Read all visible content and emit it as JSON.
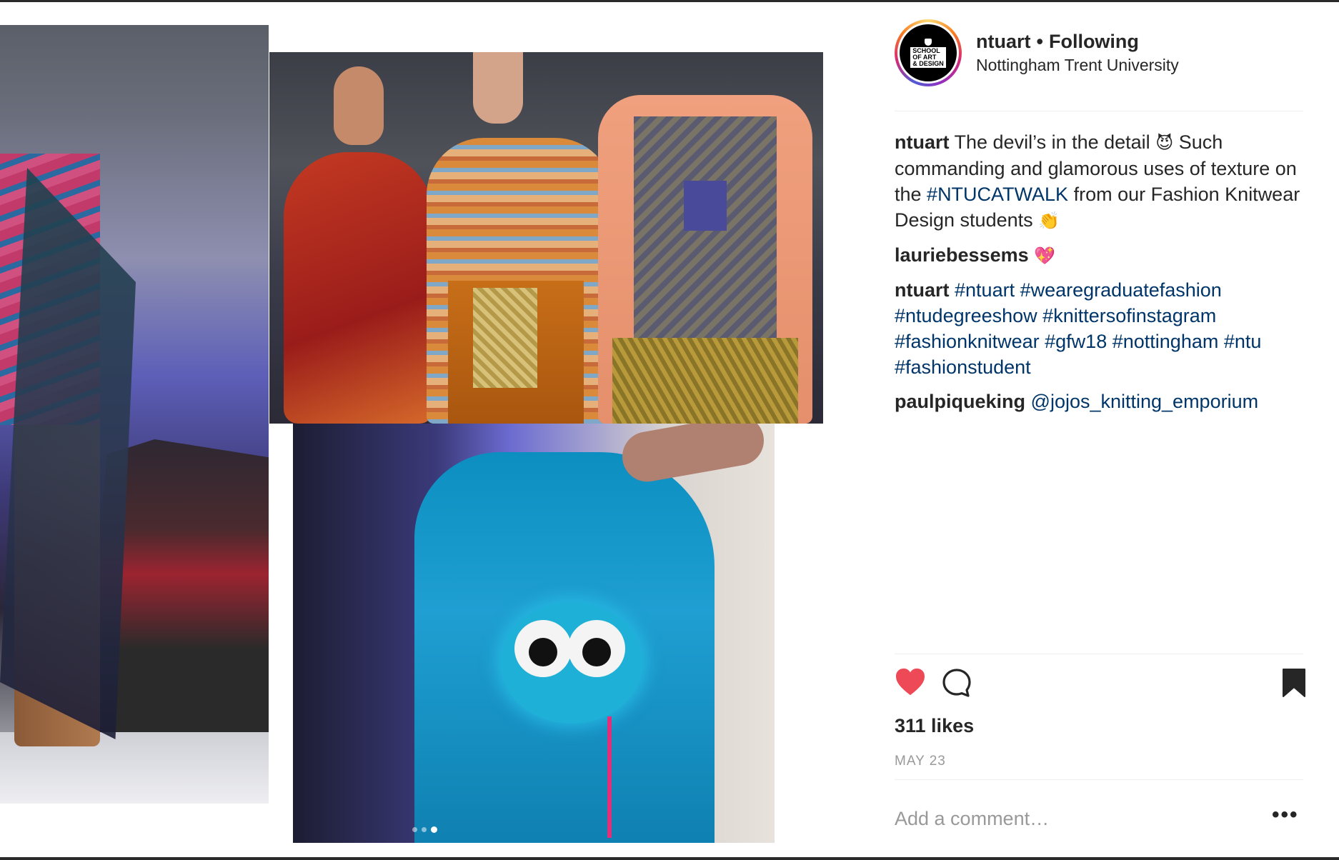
{
  "post": {
    "username": "ntuart",
    "separator": "•",
    "follow_status": "Following",
    "location": "Nottingham Trent University",
    "avatar_text": "SCHOOL\nOF ART\n& DESIGN"
  },
  "comments": [
    {
      "user": "ntuart",
      "segments": [
        {
          "type": "text",
          "value": " The devil’s in the detail "
        },
        {
          "type": "emoji",
          "value": "😈"
        },
        {
          "type": "text",
          "value": "  Such commanding and glamorous uses of texture on the "
        },
        {
          "type": "tag",
          "value": "#NTUCATWALK"
        },
        {
          "type": "text",
          "value": " from our Fashion Knitwear Design students "
        },
        {
          "type": "emoji",
          "value": "👏"
        }
      ]
    },
    {
      "user": "lauriebessems",
      "segments": [
        {
          "type": "text",
          "value": " "
        },
        {
          "type": "emoji",
          "value": "💖"
        }
      ]
    },
    {
      "user": "ntuart",
      "segments": [
        {
          "type": "text",
          "value": " "
        },
        {
          "type": "tag",
          "value": "#ntuart"
        },
        {
          "type": "text",
          "value": " "
        },
        {
          "type": "tag",
          "value": "#wearegraduatefashion"
        },
        {
          "type": "text",
          "value": " "
        },
        {
          "type": "tag",
          "value": "#ntudegreeshow"
        },
        {
          "type": "text",
          "value": " "
        },
        {
          "type": "tag",
          "value": "#knittersofinstagram"
        },
        {
          "type": "text",
          "value": " "
        },
        {
          "type": "tag",
          "value": "#fashionknitwear"
        },
        {
          "type": "text",
          "value": " "
        },
        {
          "type": "tag",
          "value": "#gfw18"
        },
        {
          "type": "text",
          "value": " "
        },
        {
          "type": "tag",
          "value": "#nottingham"
        },
        {
          "type": "text",
          "value": " "
        },
        {
          "type": "tag",
          "value": "#ntu"
        },
        {
          "type": "text",
          "value": " "
        },
        {
          "type": "tag",
          "value": "#fashionstudent"
        }
      ]
    },
    {
      "user": "paulpiqueking",
      "segments": [
        {
          "type": "text",
          "value": " "
        },
        {
          "type": "tag",
          "value": "@jojos_knitting_emporium"
        }
      ]
    }
  ],
  "actions": {
    "like_icon": "heart-icon",
    "comment_icon": "comment-bubble-icon",
    "save_icon": "bookmark-icon",
    "liked": true,
    "like_color": "#ed4956"
  },
  "likes": "311 likes",
  "date": "MAY 23",
  "add_comment_placeholder": "Add a comment…",
  "more_label": "•••",
  "carousel": {
    "count": 3,
    "active_index": 2
  },
  "colors": {
    "link": "#003569",
    "muted": "#999999",
    "text": "#262626"
  }
}
